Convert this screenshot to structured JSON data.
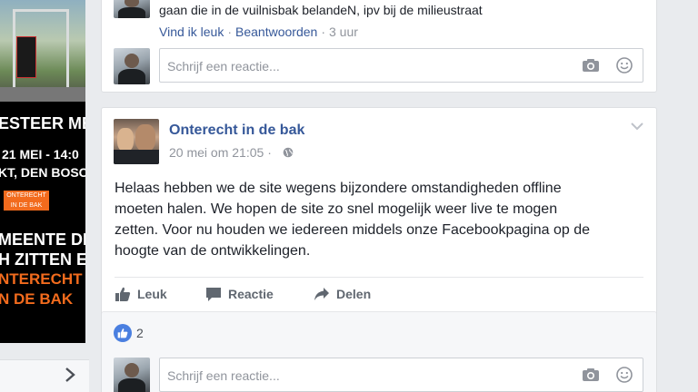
{
  "ad": {
    "banner1_lines": [
      "ESTEER ME",
      "21 MEI - 14:0",
      "KT, DEN BOSCI"
    ],
    "banner2_lines": [
      "MEENTE DE",
      "H ZITTEN ER",
      "NTERECHT",
      "N DE BAK"
    ],
    "logo_lines": [
      "ONTERECHT",
      "IN DE BAK"
    ]
  },
  "top_comment": {
    "text": "gaan die in de vuilnisbak belandeN, ipv bij de milieustraat",
    "like_label": "Vind ik leuk",
    "reply_label": "Beantwoorden",
    "time": "3 uur",
    "separator": "·"
  },
  "reply_placeholder": "Schrijf een reactie...",
  "post": {
    "page_name": "Onterecht in de bak",
    "time": "20 mei om 21:05",
    "separator": "·",
    "body_lines": [
      "Helaas hebben we de site wegens bijzondere omstandigheden offline",
      "moeten halen. We hopen de site zo snel mogelijk weer live te mogen",
      "zetten. Voor nu houden we iedereen middels onze Facebookpagina op de",
      "hoogte van de ontwikkelingen."
    ],
    "actions": {
      "like": "Leuk",
      "comment": "Reactie",
      "share": "Delen"
    },
    "like_count": "2"
  },
  "colors": {
    "link": "#365899",
    "meta": "#90949c",
    "background": "#e9ebee",
    "like_badge": "#4a7fe0",
    "brand_orange": "#f26b1d"
  },
  "icons": [
    "camera-icon",
    "smile-icon",
    "globe-icon",
    "thumbs-up-icon",
    "comment-icon",
    "share-icon",
    "chevron-down-icon",
    "chevron-right-icon"
  ]
}
